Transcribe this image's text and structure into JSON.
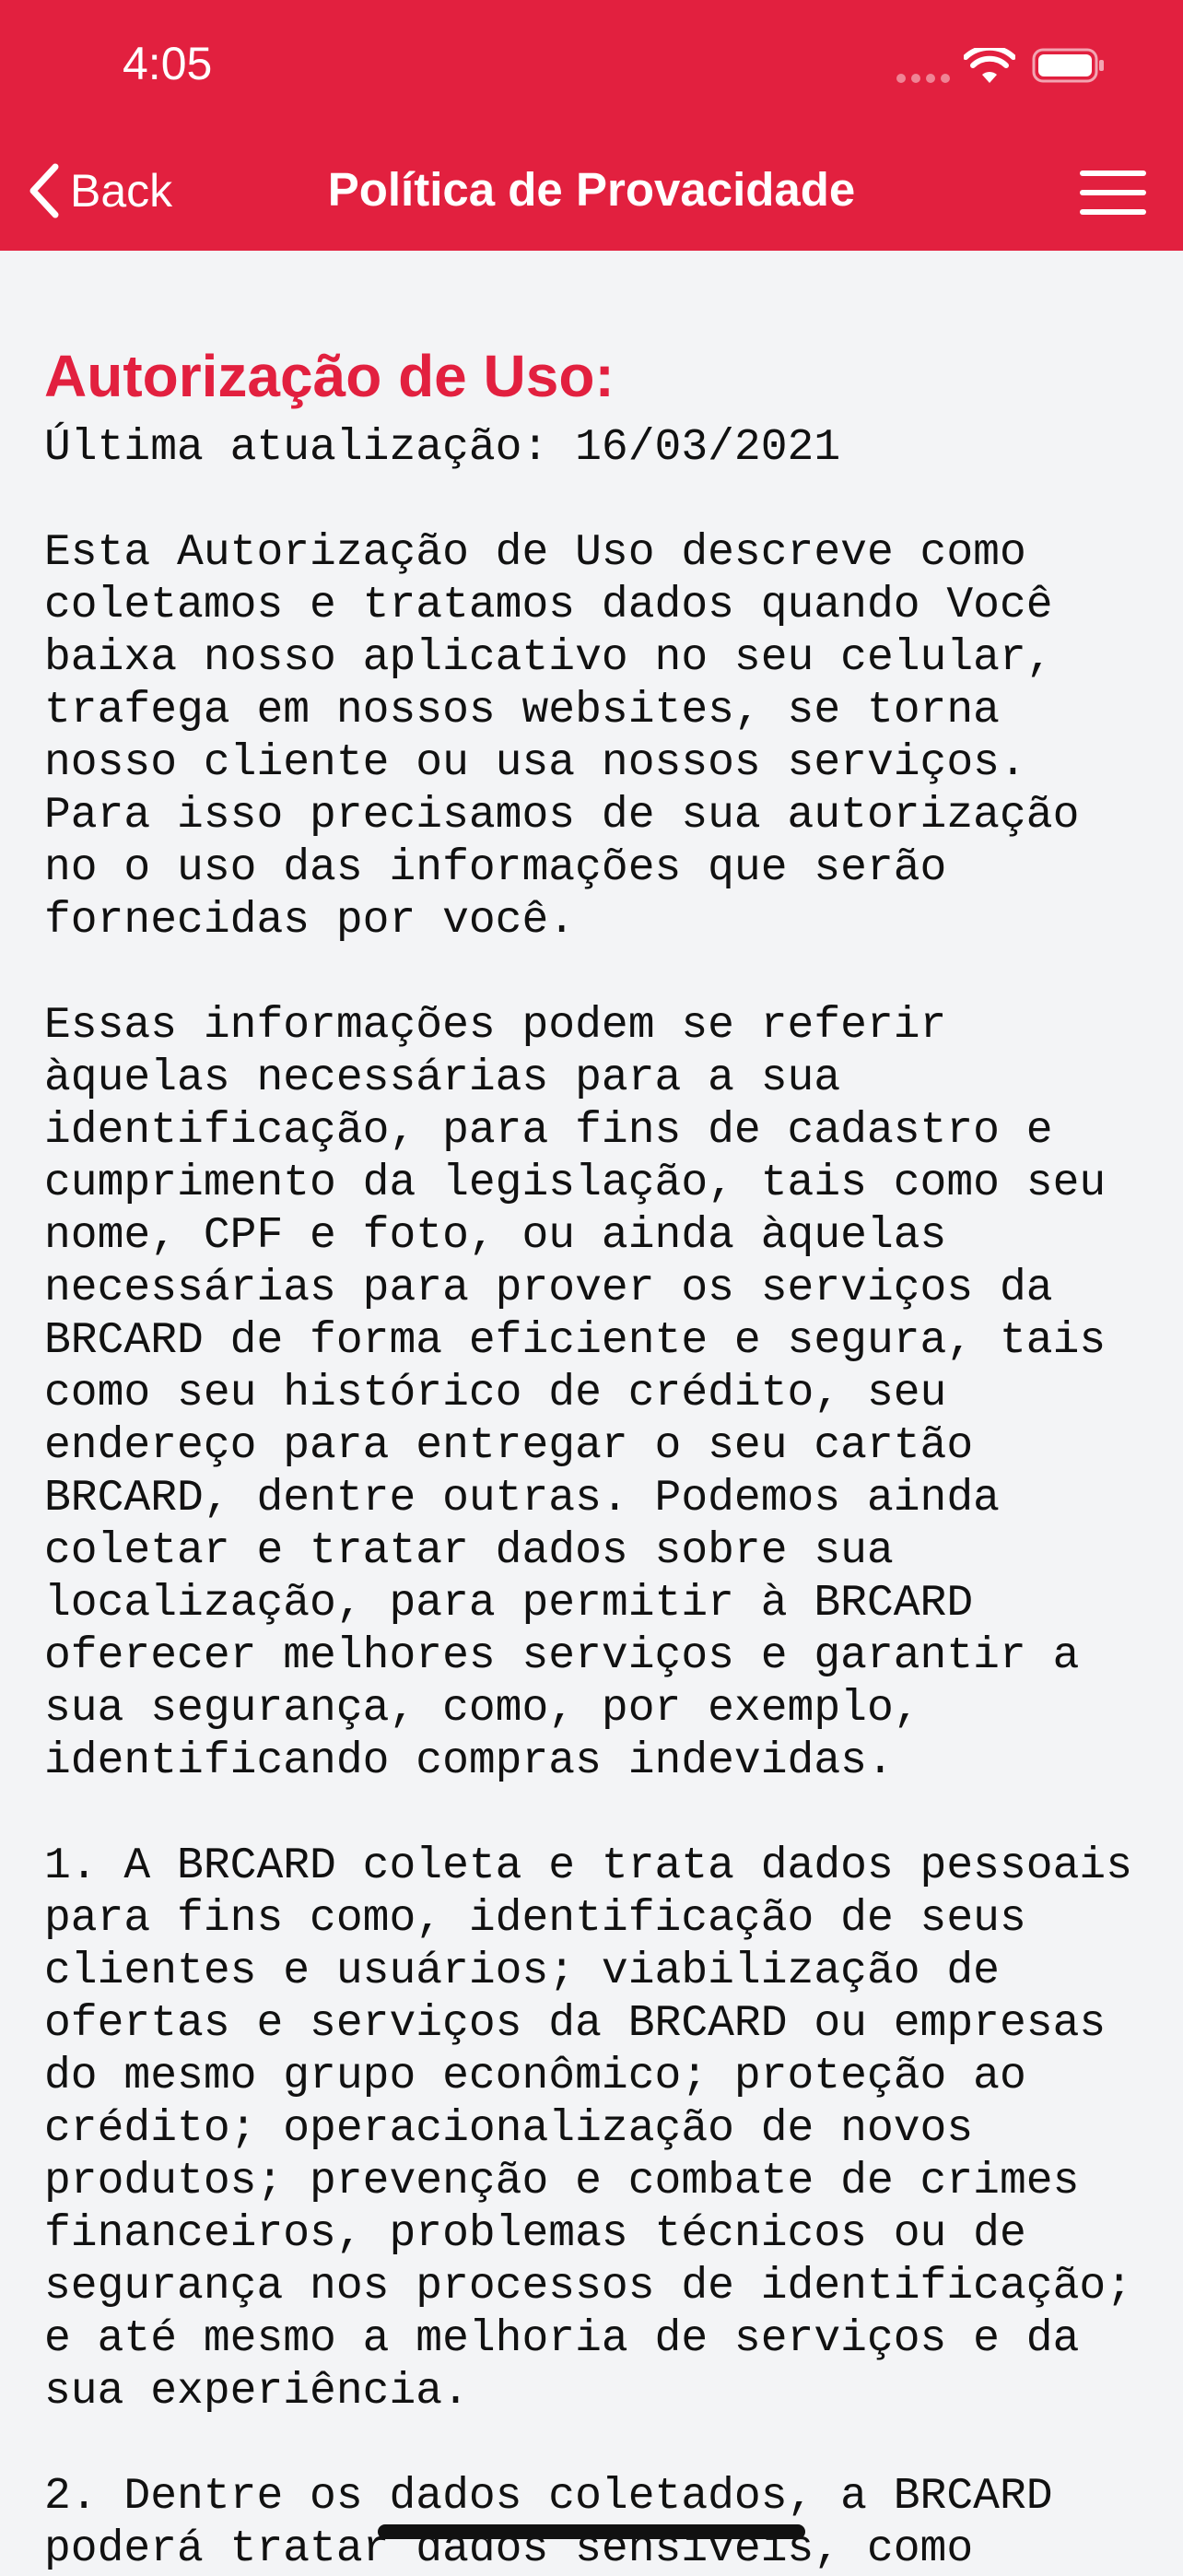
{
  "status_bar": {
    "time": "4:05"
  },
  "nav": {
    "back_label": "Back",
    "title": "Política de Provacidade"
  },
  "content": {
    "heading": "Autorização de Uso:",
    "updated": "Última atualização: 16/03/2021",
    "paragraphs": [
      "Esta Autorização de Uso descreve como\ncoletamos e tratamos dados quando Você\nbaixa nosso aplicativo no seu celular,\ntrafega em nossos websites, se torna\nnosso cliente ou usa nossos serviços.\nPara isso precisamos de sua autorização\nno o uso das informações que serão\nfornecidas por você.",
      "Essas informações podem se referir\nàquelas necessárias para a sua\nidentificação, para fins de cadastro e\ncumprimento da legislação, tais como seu\nnome, CPF e foto, ou ainda àquelas\nnecessárias para prover os serviços da\nBRCARD de forma eficiente e segura, tais\ncomo seu histórico de crédito, seu\nendereço para entregar o seu cartão\nBRCARD, dentre outras. Podemos ainda\ncoletar e tratar dados sobre sua\nlocalização, para permitir à BRCARD\noferecer melhores serviços e garantir a\nsua segurança, como, por exemplo,\nidentificando compras indevidas.",
      "1. A BRCARD coleta e trata dados pessoais\npara fins como, identificação de seus\nclientes e usuários; viabilização de\nofertas e serviços da BRCARD ou empresas\ndo mesmo grupo econômico; proteção ao\ncrédito; operacionalização de novos\nprodutos; prevenção e combate de crimes\nfinanceiros, problemas técnicos ou de\nsegurança nos processos de identificação;\ne até mesmo a melhoria de serviços e da\nsua experiência.",
      "2. Dentre os dados coletados, a BRCARD\npoderá tratar dados sensíveis, como"
    ]
  },
  "colors": {
    "accent": "#e2203f",
    "background": "#f3f4f6",
    "text": "#111111"
  },
  "icons": [
    "chevron-left-icon",
    "hamburger-menu-icon",
    "wifi-icon",
    "battery-icon",
    "signal-icon"
  ]
}
